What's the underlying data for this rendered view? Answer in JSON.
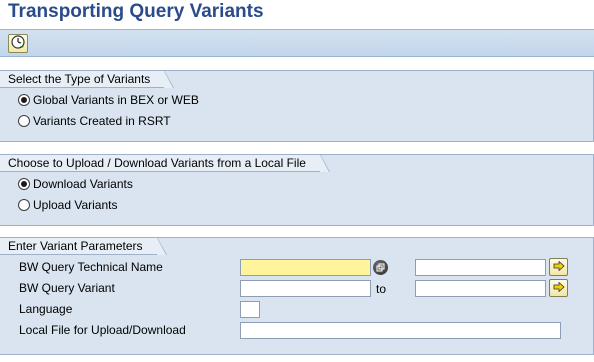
{
  "title": "Transporting Query Variants",
  "toolbar": {
    "execute_icon": "execute-clock-icon"
  },
  "section_type": {
    "header": "Select the Type of Variants",
    "options": [
      {
        "label": "Global Variants in BEX or WEB",
        "checked": true
      },
      {
        "label": "Variants Created in RSRT",
        "checked": false
      }
    ]
  },
  "section_updown": {
    "header": "Choose to Upload / Download Variants from a Local File",
    "options": [
      {
        "label": "Download Variants",
        "checked": true
      },
      {
        "label": "Upload Variants",
        "checked": false
      }
    ]
  },
  "section_params": {
    "header": "Enter Variant Parameters",
    "fields": {
      "tech_name": {
        "label": "BW Query Technical Name",
        "value": "",
        "to_value": ""
      },
      "query_variant": {
        "label": "BW Query Variant",
        "value": "",
        "to_label": "to",
        "to_value": ""
      },
      "language": {
        "label": "Language",
        "value": ""
      },
      "local_file": {
        "label": "Local File for Upload/Download",
        "value": ""
      }
    }
  },
  "colors": {
    "title": "#2b4c8a",
    "group_bg": "#d9e4f0",
    "required_field": "#fff39c"
  }
}
